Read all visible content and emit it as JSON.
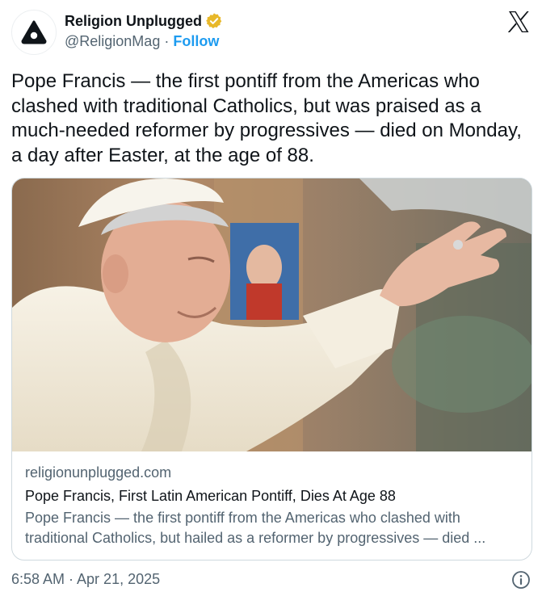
{
  "author": {
    "name": "Religion Unplugged",
    "handle": "@ReligionMag",
    "separator": "·",
    "follow_label": "Follow",
    "avatar_icon": "religion-unplugged-logo",
    "verified_icon": "gold-verified-badge",
    "verified_color": "#e8b829"
  },
  "platform_icon": "x-logo",
  "tweet": {
    "text": "Pope Francis — the first pontiff from the Americas who clashed with traditional Catholics, but was praised as a much-needed reformer by progressives — died on Monday, a day after Easter, at the age of 88."
  },
  "card": {
    "image_icon": "pope-francis-waving-photo",
    "domain": "religionunplugged.com",
    "title": "Pope Francis, First Latin American Pontiff, Dies At Age 88",
    "description": "Pope Francis — the first pontiff from the Americas who clashed with traditional Catholics, but hailed as a reformer by progressives — died ..."
  },
  "footer": {
    "timestamp": "6:58 AM · Apr 21, 2025",
    "info_icon": "info-icon"
  },
  "colors": {
    "text": "#0f1419",
    "secondary": "#536471",
    "link": "#1d9bf0",
    "border": "#cfd9de"
  }
}
